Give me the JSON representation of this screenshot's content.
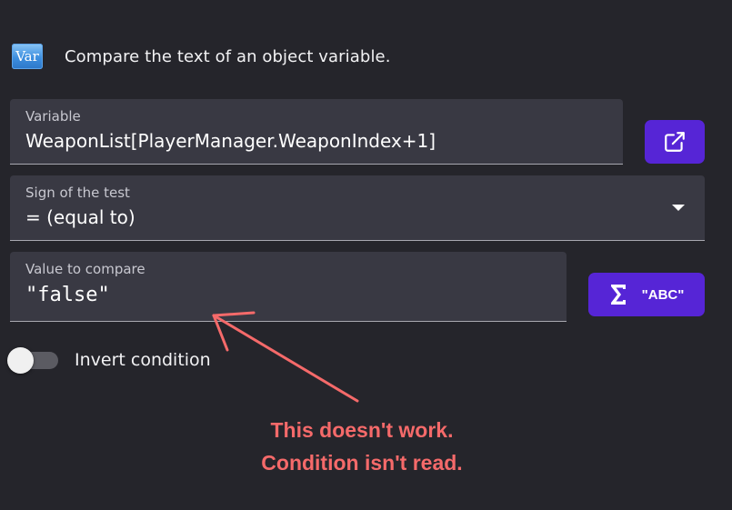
{
  "header": {
    "icon_label": "Var",
    "description": "Compare the text of an object variable."
  },
  "variable_field": {
    "label": "Variable",
    "value": "WeaponList[PlayerManager.WeaponIndex+1]"
  },
  "sign_field": {
    "label": "Sign of the test",
    "value": "= (equal to)"
  },
  "compare_field": {
    "label": "Value to compare",
    "value": "\"false\""
  },
  "expression_button": {
    "symbol": "Σ",
    "label": "\"ABC\""
  },
  "invert_toggle": {
    "label": "Invert condition",
    "checked": false
  },
  "annotation": {
    "line1": "This doesn't work.",
    "line2": "Condition isn't read.",
    "color": "#f56a6a"
  },
  "colors": {
    "background": "#25252b",
    "field": "#393943",
    "accent": "#5625d6"
  },
  "icons": [
    "var-icon",
    "open-external-icon",
    "chevron-down-icon",
    "sigma-icon"
  ]
}
